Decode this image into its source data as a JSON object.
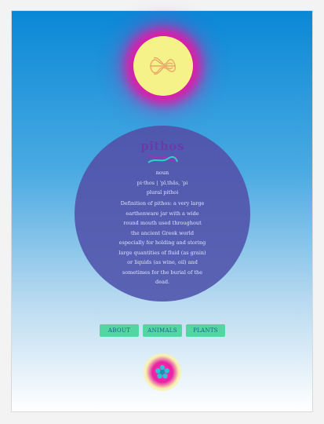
{
  "header": {
    "emblem_icon": "knot-icon"
  },
  "entry": {
    "word": "pithos",
    "word_icon": "fish-knot-icon",
    "part_of_speech": "noun",
    "pronunciation": "pi·thos | ˈpīˌthäs, ˈpi",
    "plural": "plural pithoi",
    "definition": "Definition of pithos: a very large earthenware jar with a wide round mouth used throughout the ancient Greek world especially for holding and storing large quantities of fluid (as grain) or liquids (as wine, oil) and sometimes for the burial of the dead."
  },
  "nav": {
    "items": [
      {
        "label": "ABOUT"
      },
      {
        "label": "ANIMALS"
      },
      {
        "label": "PLANTS"
      }
    ]
  },
  "footer": {
    "icon": "flower-icon"
  },
  "colors": {
    "top_gradient": "#0a88d6",
    "sun": "#f6f28a",
    "glow": "#e01aa8",
    "disc": "#5159ad",
    "button": "#53d6a2",
    "button_text": "#1f5a8f"
  }
}
